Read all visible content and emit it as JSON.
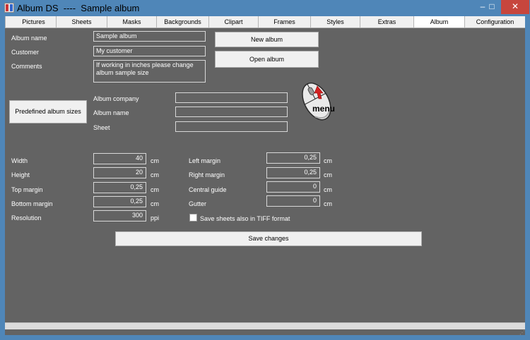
{
  "window": {
    "title": "Album DS  ----  Sample album",
    "minimize_icon": "minimize-icon",
    "maximize_icon": "maximize-icon",
    "close_icon": "close-icon",
    "min_glyph": "–",
    "max_glyph": "□",
    "close_glyph": "✕"
  },
  "tabs": [
    "Pictures",
    "Sheets",
    "Masks",
    "Backgrounds",
    "Clipart",
    "Frames",
    "Styles",
    "Extras",
    "Album",
    "Configuration"
  ],
  "active_tab": "Album",
  "album": {
    "name_label": "Album name",
    "name_value": "Sample album",
    "customer_label": "Customer",
    "customer_value": "My customer",
    "comments_label": "Comments",
    "comments_value": "If working in inches please change album sample size"
  },
  "buttons": {
    "new_album": "New album",
    "open_album": "Open album",
    "predefined_sizes": "Predefined album sizes",
    "save_changes": "Save changes"
  },
  "mouse_menu": {
    "label": "menu",
    "icon": "mouse-icon"
  },
  "predefined": {
    "company_label": "Album company",
    "company_value": "",
    "album_name_label": "Album name",
    "album_name_value": "",
    "sheet_label": "Sheet",
    "sheet_value": ""
  },
  "dimensions": {
    "width_label": "Width",
    "width_value": "40",
    "width_unit": "cm",
    "height_label": "Height",
    "height_value": "20",
    "height_unit": "cm",
    "top_margin_label": "Top margin",
    "top_margin_value": "0,25",
    "top_margin_unit": "cm",
    "bottom_margin_label": "Bottom margin",
    "bottom_margin_value": "0,25",
    "bottom_margin_unit": "cm",
    "resolution_label": "Resolution",
    "resolution_value": "300",
    "resolution_unit": "ppi",
    "left_margin_label": "Left margin",
    "left_margin_value": "0,25",
    "left_margin_unit": "cm",
    "right_margin_label": "Right margin",
    "right_margin_value": "0,25",
    "right_margin_unit": "cm",
    "central_guide_label": "Central guide",
    "central_guide_value": "0",
    "central_guide_unit": "cm",
    "gutter_label": "Gutter",
    "gutter_value": "0",
    "gutter_unit": "cm"
  },
  "tiff": {
    "label": "Save sheets also in TIFF format",
    "checked": false
  },
  "status": {
    "grip_glyph": "⋰"
  },
  "colors": {
    "titlebar": "#4f86b8",
    "client_bg": "#636363",
    "close_button": "#c7463d"
  }
}
